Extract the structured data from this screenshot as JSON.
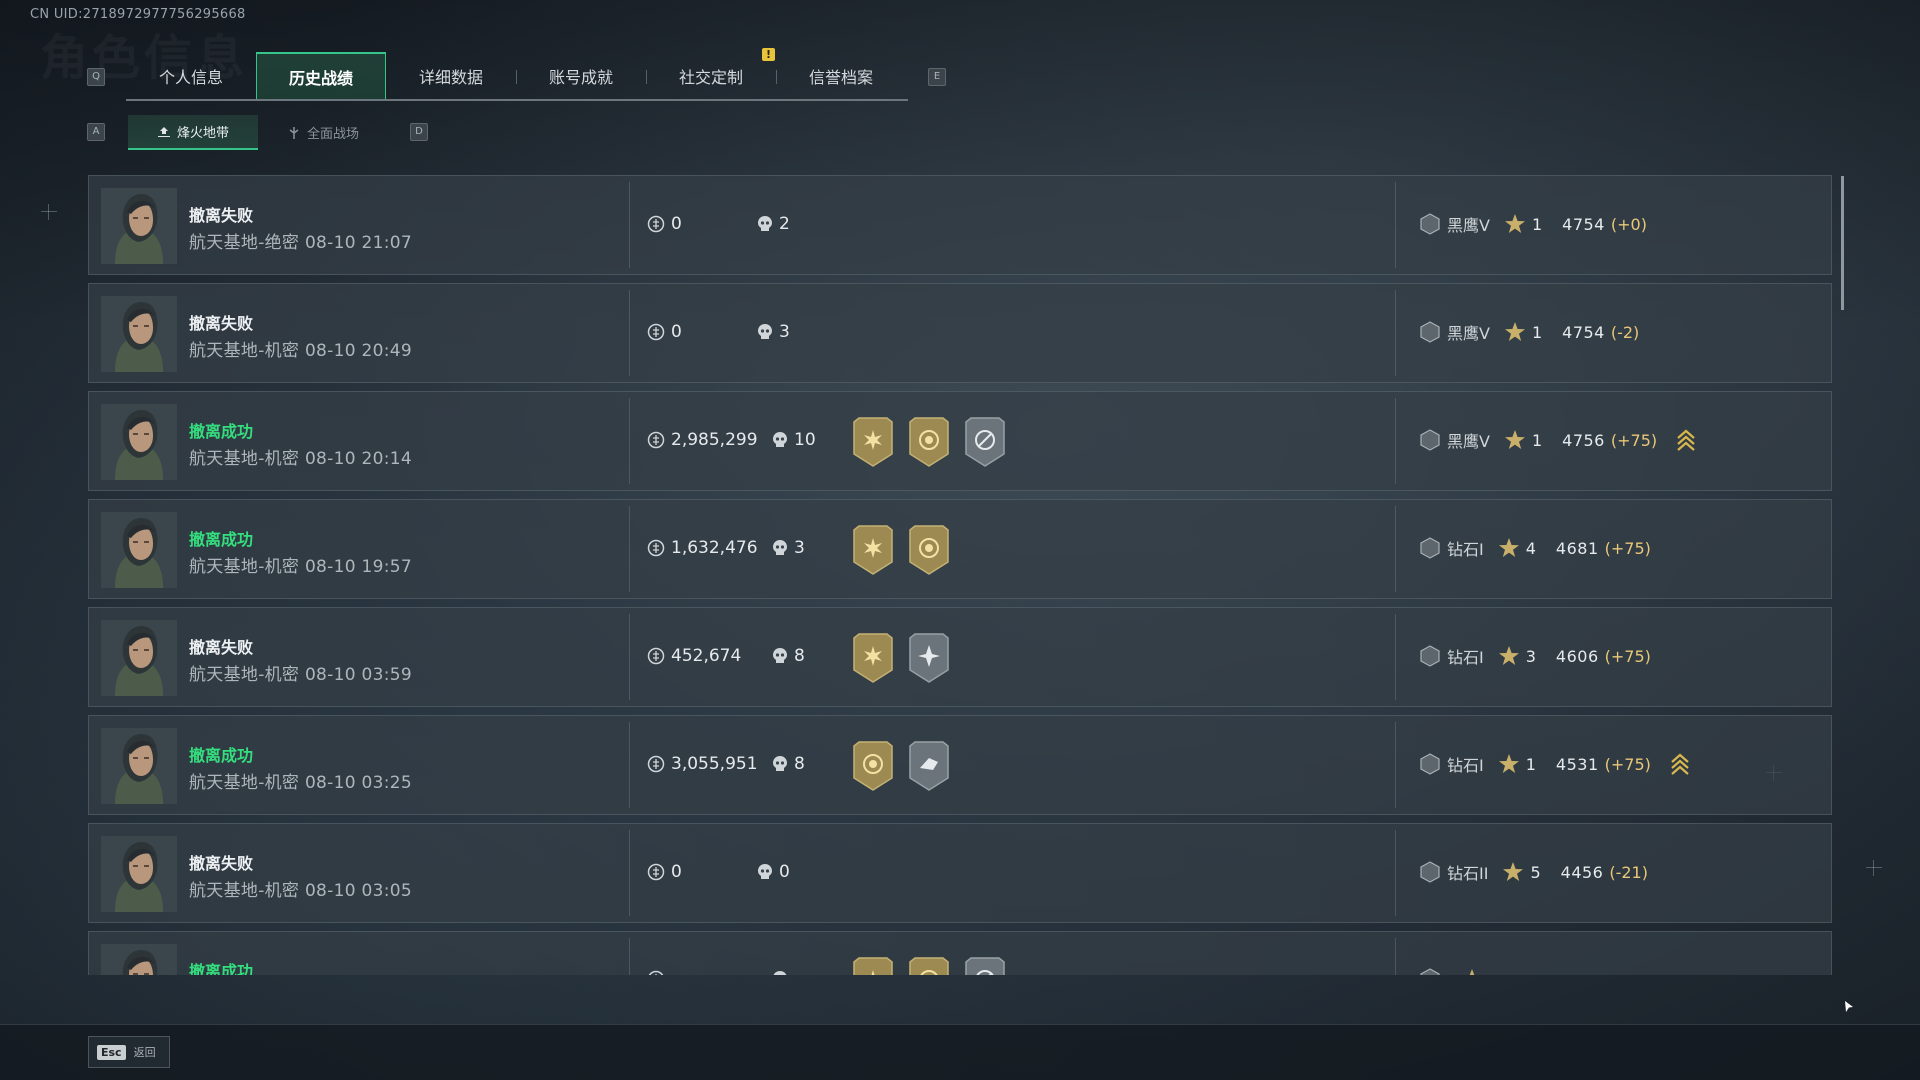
{
  "uid": "CN UID:2718972977756295668",
  "watermark": "角色信息",
  "keys": {
    "prev_tab": "Q",
    "next_tab": "E",
    "prev_sub": "A",
    "next_sub": "D",
    "tab_badge": "!"
  },
  "tabs": [
    {
      "label": "个人信息"
    },
    {
      "label": "历史战绩"
    },
    {
      "label": "详细数据"
    },
    {
      "label": "账号成就"
    },
    {
      "label": "社交定制"
    },
    {
      "label": "信誉档案"
    }
  ],
  "subtabs": [
    {
      "label": "烽火地带"
    },
    {
      "label": "全面战场"
    }
  ],
  "matches": [
    {
      "result": "撤离失败",
      "success": false,
      "meta": "航天基地-绝密 08-10 21:07",
      "money": "0",
      "kills": "2",
      "badges": [],
      "rank_icon": "V",
      "rank": "黑鹰V",
      "stars": "1",
      "score": "4754",
      "delta": "(+0)",
      "rank_up": false
    },
    {
      "result": "撤离失败",
      "success": false,
      "meta": "航天基地-机密 08-10 20:49",
      "money": "0",
      "kills": "3",
      "badges": [],
      "rank_icon": "V",
      "rank": "黑鹰V",
      "stars": "1",
      "score": "4754",
      "delta": "(-2)",
      "rank_up": false
    },
    {
      "result": "撤离成功",
      "success": true,
      "meta": "航天基地-机密 08-10 20:14",
      "money": "2,985,299",
      "kills": "10",
      "badges": [
        "gold-sun-badge",
        "gold-coin-badge",
        "silver-compass-badge"
      ],
      "rank_icon": "V",
      "rank": "黑鹰V",
      "stars": "1",
      "score": "4756",
      "delta": "(+75)",
      "rank_up": true
    },
    {
      "result": "撤离成功",
      "success": true,
      "meta": "航天基地-机密 08-10 19:57",
      "money": "1,632,476",
      "kills": "3",
      "badges": [
        "gold-sun-badge",
        "gold-coin-badge"
      ],
      "rank_icon": "I",
      "rank": "钻石I",
      "stars": "4",
      "score": "4681",
      "delta": "(+75)",
      "rank_up": false
    },
    {
      "result": "撤离失败",
      "success": false,
      "meta": "航天基地-机密 08-10 03:59",
      "money": "452,674",
      "kills": "8",
      "badges": [
        "gold-sun-badge",
        "silver-burst-badge"
      ],
      "rank_icon": "I",
      "rank": "钻石I",
      "stars": "3",
      "score": "4606",
      "delta": "(+75)",
      "rank_up": false
    },
    {
      "result": "撤离成功",
      "success": true,
      "meta": "航天基地-机密 08-10 03:25",
      "money": "3,055,951",
      "kills": "8",
      "badges": [
        "gold-coin-badge",
        "silver-hand-badge"
      ],
      "rank_icon": "I",
      "rank": "钻石I",
      "stars": "1",
      "score": "4531",
      "delta": "(+75)",
      "rank_up": true
    },
    {
      "result": "撤离失败",
      "success": false,
      "meta": "航天基地-机密 08-10 03:05",
      "money": "0",
      "kills": "0",
      "badges": [],
      "rank_icon": "II",
      "rank": "钻石II",
      "stars": "5",
      "score": "4456",
      "delta": "(-21)",
      "rank_up": false
    },
    {
      "result": "撤离成功",
      "success": true,
      "meta": "",
      "money": "",
      "kills": "",
      "badges": [
        "gold-sun-badge",
        "gold-coin-badge",
        "silver-compass-badge"
      ],
      "rank_icon": "II",
      "rank": "",
      "stars": "",
      "score": "",
      "delta": "",
      "rank_up": false
    }
  ],
  "footer": {
    "esc_key": "Esc",
    "esc_label": "返回"
  },
  "colors": {
    "accent": "#35c48a",
    "success": "#34de7e",
    "gold": "#e8c878",
    "badge_gold": "#9c8a52",
    "badge_silver": "#6b747a"
  }
}
